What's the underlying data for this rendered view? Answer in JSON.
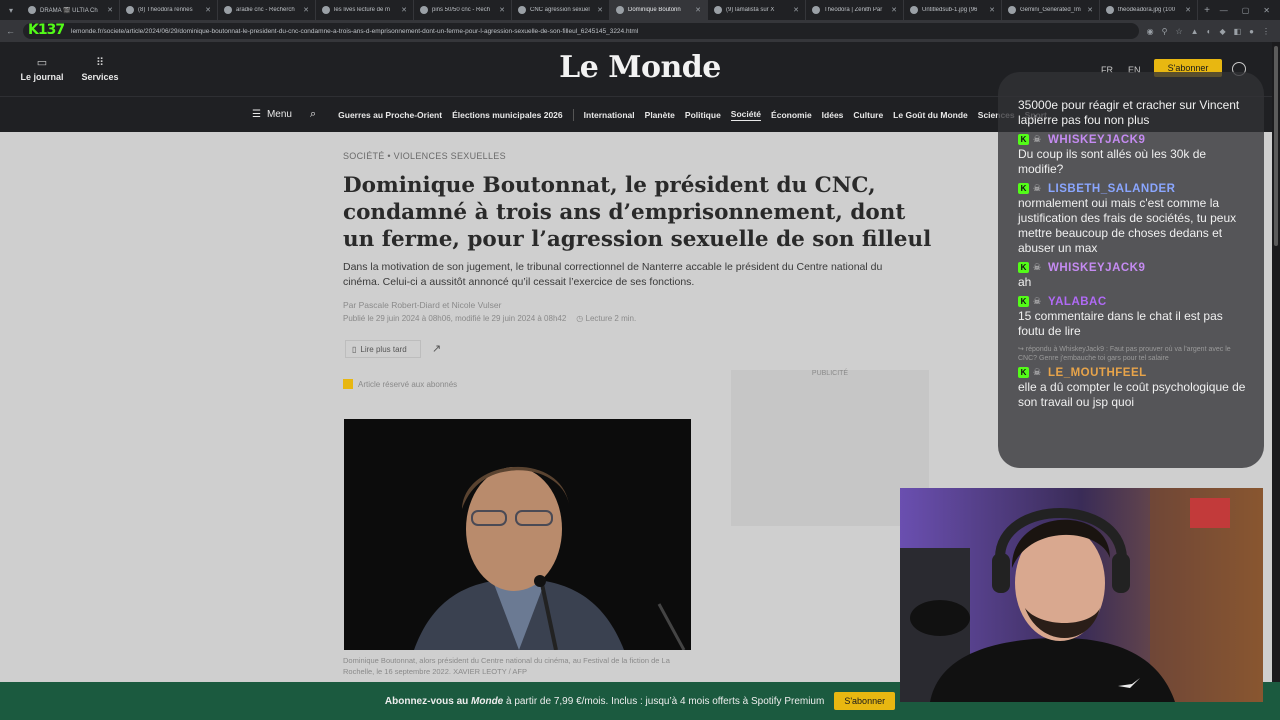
{
  "browser": {
    "tabs": [
      {
        "title": "DRAMA 🎬 ULTIA Ch",
        "active": false
      },
      {
        "title": "(8) Theodora rennes",
        "active": false
      },
      {
        "title": "aradie cnc - Recherch",
        "active": false
      },
      {
        "title": "les lives lecture de m",
        "active": false
      },
      {
        "title": "pins 50/50 cnc - Rech",
        "active": false
      },
      {
        "title": "CNC agression sexuel",
        "active": false
      },
      {
        "title": "Dominique Boutonn",
        "active": true
      },
      {
        "title": "(9) lamalista sur X",
        "active": false
      },
      {
        "title": "Theodora | Zénith Par",
        "active": false
      },
      {
        "title": "Untitledsub-1.jpg (96",
        "active": false
      },
      {
        "title": "Gemini_Generated_Im",
        "active": false
      },
      {
        "title": "theodeadora.jpg (100",
        "active": false
      }
    ],
    "url": "lemonde.fr/societe/article/2024/06/29/dominique-boutonnat-le-president-du-cnc-condamne-a-trois-ans-d-emprisonnement-dont-un-ferme-pour-l-agression-sexuelle-de-son-filleul_6245145_3224.html",
    "overlay_logo": "K137"
  },
  "header": {
    "journal_label": "Le journal",
    "services_label": "Services",
    "logo": "Le Monde",
    "lang_fr": "FR",
    "lang_en": "EN",
    "subscribe_label": "S'abonner"
  },
  "nav": {
    "menu_label": "Menu",
    "items": [
      {
        "label": "Guerres au Proche-Orient",
        "active": false
      },
      {
        "label": "Élections municipales 2026",
        "active": false
      },
      {
        "label": "International",
        "active": false
      },
      {
        "label": "Planète",
        "active": false
      },
      {
        "label": "Politique",
        "active": false
      },
      {
        "label": "Société",
        "active": true
      },
      {
        "label": "Économie",
        "active": false
      },
      {
        "label": "Idées",
        "active": false
      },
      {
        "label": "Culture",
        "active": false
      },
      {
        "label": "Le Goût du Monde",
        "active": false
      },
      {
        "label": "Sciences",
        "active": false
      },
      {
        "label": "Sport",
        "active": false
      }
    ]
  },
  "article": {
    "kicker": "SOCIÉTÉ • VIOLENCES SEXUELLES",
    "headline": "Dominique Boutonnat, le président du CNC, condamné à trois ans d’emprisonnement, dont un ferme, pour l’agression sexuelle de son filleul",
    "chapo": "Dans la motivation de son jugement, le tribunal correctionnel de Nanterre accable le président du Centre national du cinéma. Celui-ci a aussitôt annoncé qu’il cessait l’exercice de ses fonctions.",
    "byline": "Par Pascale Robert-Diard et Nicole Vulser",
    "published": "Publié le 29 juin 2024 à 08h06, modifié le 29 juin 2024 à 08h42",
    "reading_time": "Lecture 2 min.",
    "read_later_label": "Lire plus tard",
    "subscribers_label": "Article réservé aux abonnés",
    "ad_label": "PUBLICITÉ",
    "caption": "Dominique Boutonnat, alors président du Centre national du cinéma, au Festival de la fiction de La Rochelle, le 16 septembre 2022. XAVIER LEOTY / AFP"
  },
  "promo": {
    "text_before": "Abonnez-vous au ",
    "brand": "Monde",
    "text_after": " à partir de 7,99 €/mois. Inclus : jusqu’à 4 mois offerts à Spotify Premium",
    "button_label": "S'abonner"
  },
  "chat": {
    "top_text": "35000e pour réagir et cracher sur Vincent lapierre pas fou non plus",
    "messages": [
      {
        "user": "WHISKEYJACK9",
        "color": "#c58bf2",
        "text": "Du coup ils sont allés où les 30k de modifie?",
        "reply": ""
      },
      {
        "user": "LISBETH_SALANDER",
        "color": "#8aa6ff",
        "text": "normalement oui mais c'est comme la justification des frais de sociétés, tu peux mettre beaucoup de choses dedans et abuser un max",
        "reply": ""
      },
      {
        "user": "WHISKEYJACK9",
        "color": "#c58bf2",
        "text": "ah",
        "reply": ""
      },
      {
        "user": "YALABAC",
        "color": "#b06af5",
        "text": "15 commentaire dans le chat il est pas foutu de lire",
        "reply": ""
      },
      {
        "user": "LE_MOUTHFEEL",
        "color": "#e8a44a",
        "text": "elle a dû compter le coût psychologique de son travail ou jsp quoi",
        "reply": "↪ répondu à WhiskeyJack9 : Faut pas prouver où va l'argent avec le CNC? Genre j'embauche toi gars pour tel salaire"
      }
    ]
  }
}
